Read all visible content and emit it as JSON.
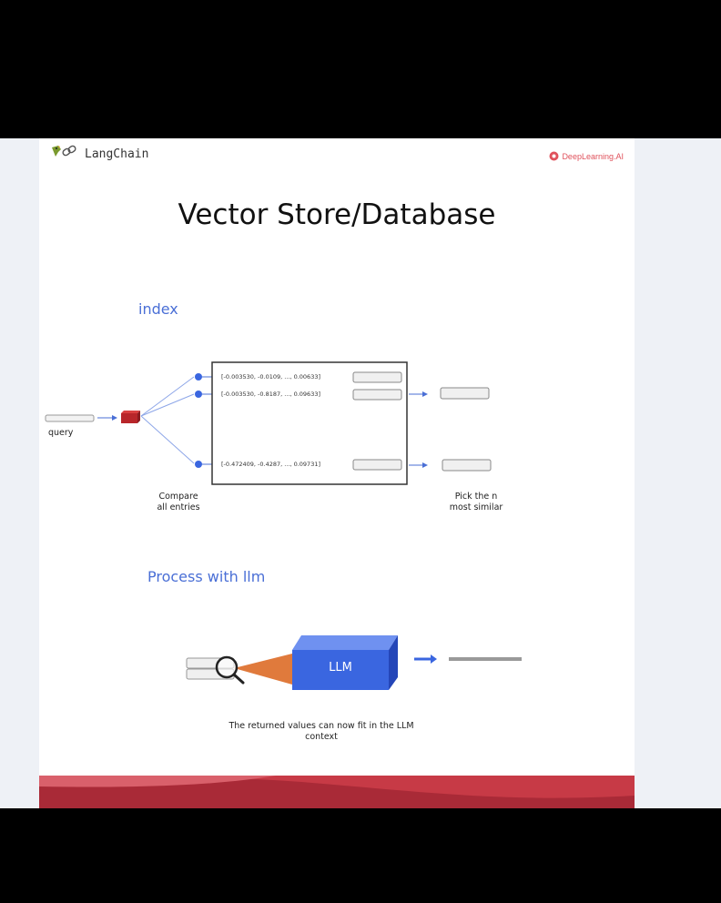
{
  "header": {
    "left_logo_text": "LangChain",
    "right_logo_text": "DeepLearning.AI"
  },
  "slide": {
    "title": "Vector Store/Database",
    "index_label": "index",
    "query_label": "query",
    "vectors": [
      "[-0.003530, -0.0109, ..., 0.00633]",
      "[-0.003530, -0.8187, ..., 0.09633]",
      "[-0.472409, -0.4287, ..., 0.09731]"
    ],
    "compare_label_line1": "Compare",
    "compare_label_line2": "all entries",
    "pick_label_line1": "Pick the n",
    "pick_label_line2": "most similar",
    "process_label": "Process with llm",
    "llm_label": "LLM",
    "caption_line1": "The returned values can now fit in the LLM",
    "caption_line2": "context"
  },
  "colors": {
    "accent_blue": "#4a6fd6",
    "llm_box": "#3a66e0",
    "footer_red": "#c73a46",
    "query_block": "#b8262a",
    "beam": "#e07a3c"
  },
  "icons": [
    "parrot-chain-icon",
    "deeplearning-logo-icon",
    "magnifier-icon"
  ]
}
